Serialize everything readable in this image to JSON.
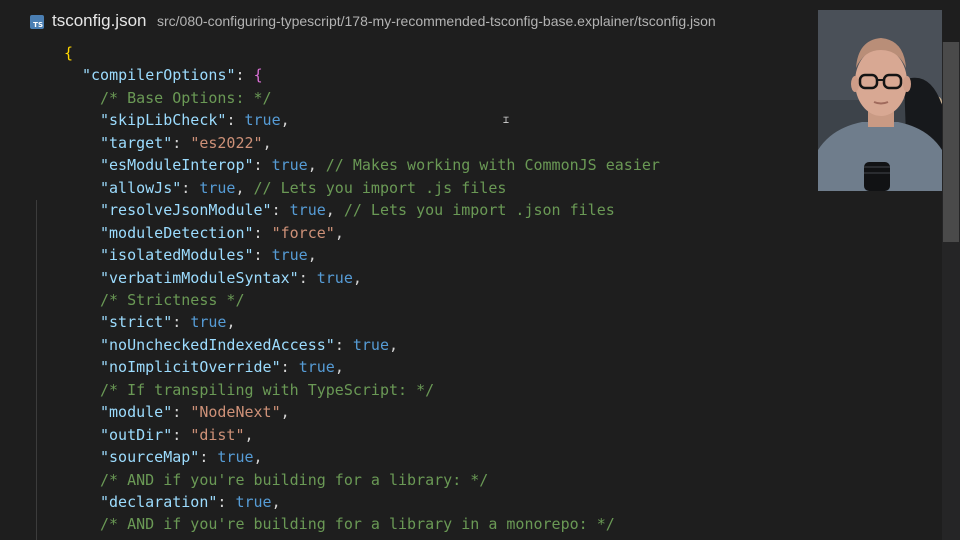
{
  "tab": {
    "icon": "typescript-file-icon",
    "icon_text": "TS",
    "filename": "tsconfig.json",
    "path": "src/080-configuring-typescript/178-my-recommended-tsconfig-base.explainer/tsconfig.json"
  },
  "code_lines": [
    [
      [
        "{",
        "brace1"
      ]
    ],
    [
      [
        "\"compilerOptions\"",
        "key"
      ],
      [
        ": ",
        "punc"
      ],
      [
        "{",
        "brace2"
      ]
    ],
    [
      [
        "/* Base Options: */",
        "cmt"
      ]
    ],
    [
      [
        "\"skipLibCheck\"",
        "key"
      ],
      [
        ": ",
        "punc"
      ],
      [
        "true",
        "bool"
      ],
      [
        ",",
        "punc"
      ]
    ],
    [
      [
        "\"target\"",
        "key"
      ],
      [
        ": ",
        "punc"
      ],
      [
        "\"es2022\"",
        "str"
      ],
      [
        ",",
        "punc"
      ]
    ],
    [
      [
        "\"esModuleInterop\"",
        "key"
      ],
      [
        ": ",
        "punc"
      ],
      [
        "true",
        "bool"
      ],
      [
        ", ",
        "punc"
      ],
      [
        "// Makes working with CommonJS easier",
        "cmt"
      ]
    ],
    [
      [
        "\"allowJs\"",
        "key"
      ],
      [
        ": ",
        "punc"
      ],
      [
        "true",
        "bool"
      ],
      [
        ", ",
        "punc"
      ],
      [
        "// Lets you import .js files",
        "cmt"
      ]
    ],
    [
      [
        "\"resolveJsonModule\"",
        "key"
      ],
      [
        ": ",
        "punc"
      ],
      [
        "true",
        "bool"
      ],
      [
        ", ",
        "punc"
      ],
      [
        "// Lets you import .json files",
        "cmt"
      ]
    ],
    [
      [
        "\"moduleDetection\"",
        "key"
      ],
      [
        ": ",
        "punc"
      ],
      [
        "\"force\"",
        "str"
      ],
      [
        ",",
        "punc"
      ]
    ],
    [
      [
        "\"isolatedModules\"",
        "key"
      ],
      [
        ": ",
        "punc"
      ],
      [
        "true",
        "bool"
      ],
      [
        ",",
        "punc"
      ]
    ],
    [
      [
        "\"verbatimModuleSyntax\"",
        "key"
      ],
      [
        ": ",
        "punc"
      ],
      [
        "true",
        "bool"
      ],
      [
        ",",
        "punc"
      ]
    ],
    [
      [
        "/* Strictness */",
        "cmt"
      ]
    ],
    [
      [
        "\"strict\"",
        "key"
      ],
      [
        ": ",
        "punc"
      ],
      [
        "true",
        "bool"
      ],
      [
        ",",
        "punc"
      ]
    ],
    [
      [
        "\"noUncheckedIndexedAccess\"",
        "key"
      ],
      [
        ": ",
        "punc"
      ],
      [
        "true",
        "bool"
      ],
      [
        ",",
        "punc"
      ]
    ],
    [
      [
        "\"noImplicitOverride\"",
        "key"
      ],
      [
        ": ",
        "punc"
      ],
      [
        "true",
        "bool"
      ],
      [
        ",",
        "punc"
      ]
    ],
    [
      [
        "/* If transpiling with TypeScript: */",
        "cmt"
      ]
    ],
    [
      [
        "\"module\"",
        "key"
      ],
      [
        ": ",
        "punc"
      ],
      [
        "\"NodeNext\"",
        "str"
      ],
      [
        ",",
        "punc"
      ]
    ],
    [
      [
        "\"outDir\"",
        "key"
      ],
      [
        ": ",
        "punc"
      ],
      [
        "\"dist\"",
        "str"
      ],
      [
        ",",
        "punc"
      ]
    ],
    [
      [
        "\"sourceMap\"",
        "key"
      ],
      [
        ": ",
        "punc"
      ],
      [
        "true",
        "bool"
      ],
      [
        ",",
        "punc"
      ]
    ],
    [
      [
        "/* AND if you're building for a library: */",
        "cmt"
      ]
    ],
    [
      [
        "\"declaration\"",
        "key"
      ],
      [
        ": ",
        "punc"
      ],
      [
        "true",
        "bool"
      ],
      [
        ",",
        "punc"
      ]
    ],
    [
      [
        "/* AND if you're building for a library in a monorepo: */",
        "cmt"
      ]
    ]
  ],
  "colors": {
    "background": "#1e1e1e",
    "key": "#9cdcfe",
    "string": "#ce9178",
    "boolean": "#569cd6",
    "comment": "#6a9955",
    "brace_outer": "#ffd700",
    "brace_inner": "#da70d6",
    "typescript_icon": "#4b7fb3"
  }
}
